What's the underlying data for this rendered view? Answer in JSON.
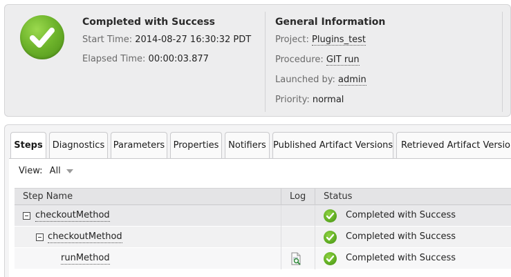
{
  "summary": {
    "status_title": "Completed with Success",
    "start_time_label": "Start Time:",
    "start_time_value": "2014-08-27 16:30:32 PDT",
    "elapsed_time_label": "Elapsed Time:",
    "elapsed_time_value": "00:00:03.877",
    "general_title": "General Information",
    "project_label": "Project:",
    "project_value": "Plugins_test",
    "procedure_label": "Procedure:",
    "procedure_value": "GIT run",
    "launched_by_label": "Launched by:",
    "launched_by_value": "admin",
    "priority_label": "Priority:",
    "priority_value": "normal"
  },
  "tabs": [
    {
      "label": "Steps",
      "active": true
    },
    {
      "label": "Diagnostics",
      "active": false
    },
    {
      "label": "Parameters",
      "active": false
    },
    {
      "label": "Properties",
      "active": false
    },
    {
      "label": "Notifiers",
      "active": false
    },
    {
      "label": "Published Artifact Versions",
      "active": false
    },
    {
      "label": "Retrieved Artifact Versions",
      "active": false
    }
  ],
  "view": {
    "label": "View:",
    "selected": "All"
  },
  "grid": {
    "columns": [
      "Step Name",
      "Log",
      "Status"
    ],
    "rows": [
      {
        "name": "checkoutMethod",
        "level": 0,
        "expandable": true,
        "has_log": false,
        "status": "Completed with Success"
      },
      {
        "name": "checkoutMethod",
        "level": 1,
        "expandable": true,
        "has_log": false,
        "status": "Completed with Success"
      },
      {
        "name": "runMethod",
        "level": 2,
        "expandable": false,
        "has_log": true,
        "status": "Completed with Success"
      }
    ]
  },
  "colors": {
    "success_green": "#6fb52c",
    "panel_bg": "#ededee",
    "header_bg": "#e4e4e6"
  },
  "icons": {
    "status": "success-check-icon",
    "log": "log-file-icon",
    "expander": "collapse-minus-icon",
    "dropdown": "chevron-down-icon"
  }
}
